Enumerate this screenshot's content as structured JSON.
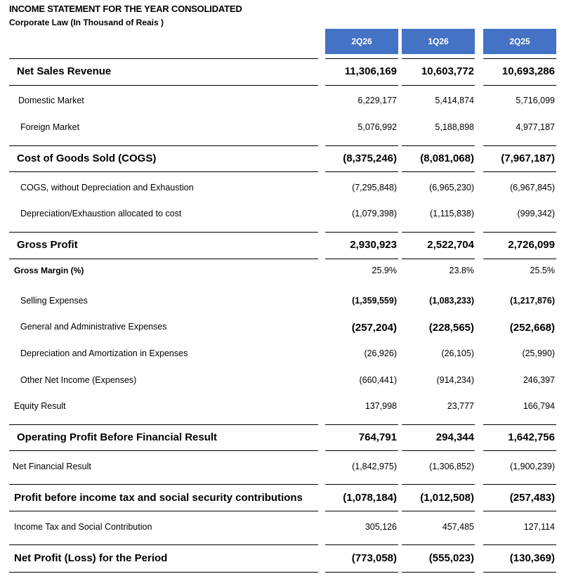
{
  "title": "INCOME STATEMENT FOR THE YEAR CONSOLIDATED",
  "subtitle": "Corporate Law (In Thousand of Reais )",
  "columns": [
    "2Q26",
    "1Q26",
    "2Q25"
  ],
  "rows": [
    {
      "label": "Net Sales Revenue",
      "values": [
        "11,306,169",
        "10,603,772",
        "10,693,286"
      ]
    },
    {
      "label": "Domestic Market",
      "values": [
        "6,229,177",
        "5,414,874",
        "5,716,099"
      ]
    },
    {
      "label": "Foreign Market",
      "values": [
        "5,076,992",
        "5,188,898",
        "4,977,187"
      ]
    },
    {
      "label": "Cost of Goods Sold (COGS)",
      "values": [
        "(8,375,246)",
        "(8,081,068)",
        "(7,967,187)"
      ]
    },
    {
      "label": "COGS, without Depreciation and Exhaustion",
      "values": [
        "(7,295,848)",
        "(6,965,230)",
        "(6,967,845)"
      ]
    },
    {
      "label": "Depreciation/Exhaustion allocated to cost",
      "values": [
        "(1,079,398)",
        "(1,115,838)",
        "(999,342)"
      ]
    },
    {
      "label": "Gross Profit",
      "values": [
        "2,930,923",
        "2,522,704",
        "2,726,099"
      ]
    },
    {
      "label": "Gross Margin (%)",
      "values": [
        "25.9%",
        "23.8%",
        "25.5%"
      ]
    },
    {
      "label": "Selling Expenses",
      "values": [
        "(1,359,559)",
        "(1,083,233)",
        "(1,217,876)"
      ]
    },
    {
      "label": "General and Administrative Expenses",
      "values": [
        "(257,204)",
        "(228,565)",
        "(252,668)"
      ]
    },
    {
      "label": "Depreciation and Amortization in Expenses",
      "values": [
        "(26,926)",
        "(26,105)",
        "(25,990)"
      ]
    },
    {
      "label": "Other Net Income (Expenses)",
      "values": [
        "(660,441)",
        "(914,234)",
        "246,397"
      ]
    },
    {
      "label": "Equity Result",
      "values": [
        "137,998",
        "23,777",
        "166,794"
      ]
    },
    {
      "label": "Operating Profit Before Financial Result",
      "values": [
        "764,791",
        "294,344",
        "1,642,756"
      ]
    },
    {
      "label": "Net Financial Result",
      "values": [
        "(1,842,975)",
        "(1,306,852)",
        "(1,900,239)"
      ]
    },
    {
      "label": "Profit before income tax and social security contributions",
      "values": [
        "(1,078,184)",
        "(1,012,508)",
        "(257,483)"
      ]
    },
    {
      "label": "Income Tax and Social Contribution",
      "values": [
        "305,126",
        "457,485",
        "127,114"
      ]
    },
    {
      "label": "Net Profit (Loss) for the Period",
      "values": [
        "(773,058)",
        "(555,023)",
        "(130,369)"
      ]
    }
  ]
}
